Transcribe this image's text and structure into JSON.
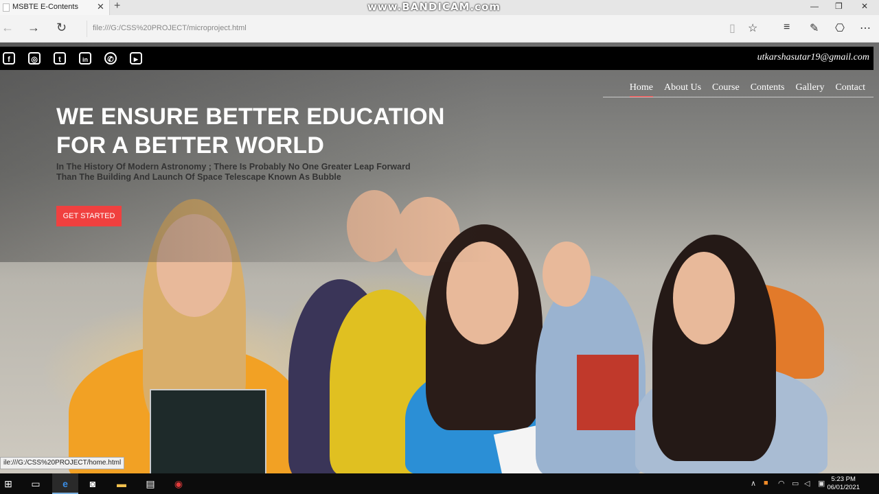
{
  "browser": {
    "tab_title": "MSBTE E-Contents",
    "tab_close": "✕",
    "new_tab": "+",
    "watermark": "www.BANDICAM.com",
    "url": "file:///G:/CSS%20PROJECT/microproject.html",
    "status_url": "ile:///G:/CSS%20PROJECT/home.html",
    "icons": {
      "back": "←",
      "forward": "→",
      "refresh": "↻",
      "reading_view": "▯",
      "favorite": "☆",
      "hub": "≡",
      "note": "✎",
      "share": "⎔",
      "more": "⋯",
      "minimize": "—",
      "maximize": "❐",
      "close": "✕"
    }
  },
  "page": {
    "social": [
      {
        "name": "facebook-icon",
        "glyph": "f"
      },
      {
        "name": "instagram-icon",
        "glyph": "◎"
      },
      {
        "name": "twitter-icon",
        "glyph": "t"
      },
      {
        "name": "linkedin-icon",
        "glyph": "in"
      },
      {
        "name": "whatsapp-icon",
        "glyph": "✆"
      },
      {
        "name": "youtube-icon",
        "glyph": "▶"
      }
    ],
    "email": "utkarshasutar19@gmail.com",
    "nav": [
      "Home",
      "About Us",
      "Course",
      "Contents",
      "Gallery",
      "Contact"
    ],
    "nav_active": "Home",
    "headline_line1": "WE ENSURE BETTER EDUCATION",
    "headline_line2": "FOR A BETTER WORLD",
    "tagline": "In The History Of Modern Astronomy ; There Is Probably No One Greater Leap Forward Than The Building And Launch Of Space Telescape Known As Bubble",
    "cta_label": "GET STARTED"
  },
  "taskbar": {
    "time": "5:23 PM",
    "date": "06/01/2021",
    "icons": [
      "windows-start-icon",
      "task-view-icon",
      "edge-icon",
      "camera-icon",
      "file-explorer-icon",
      "notepad-icon",
      "record-icon"
    ]
  },
  "colors": {
    "accent": "#f0403f",
    "topbar": "#000000"
  }
}
